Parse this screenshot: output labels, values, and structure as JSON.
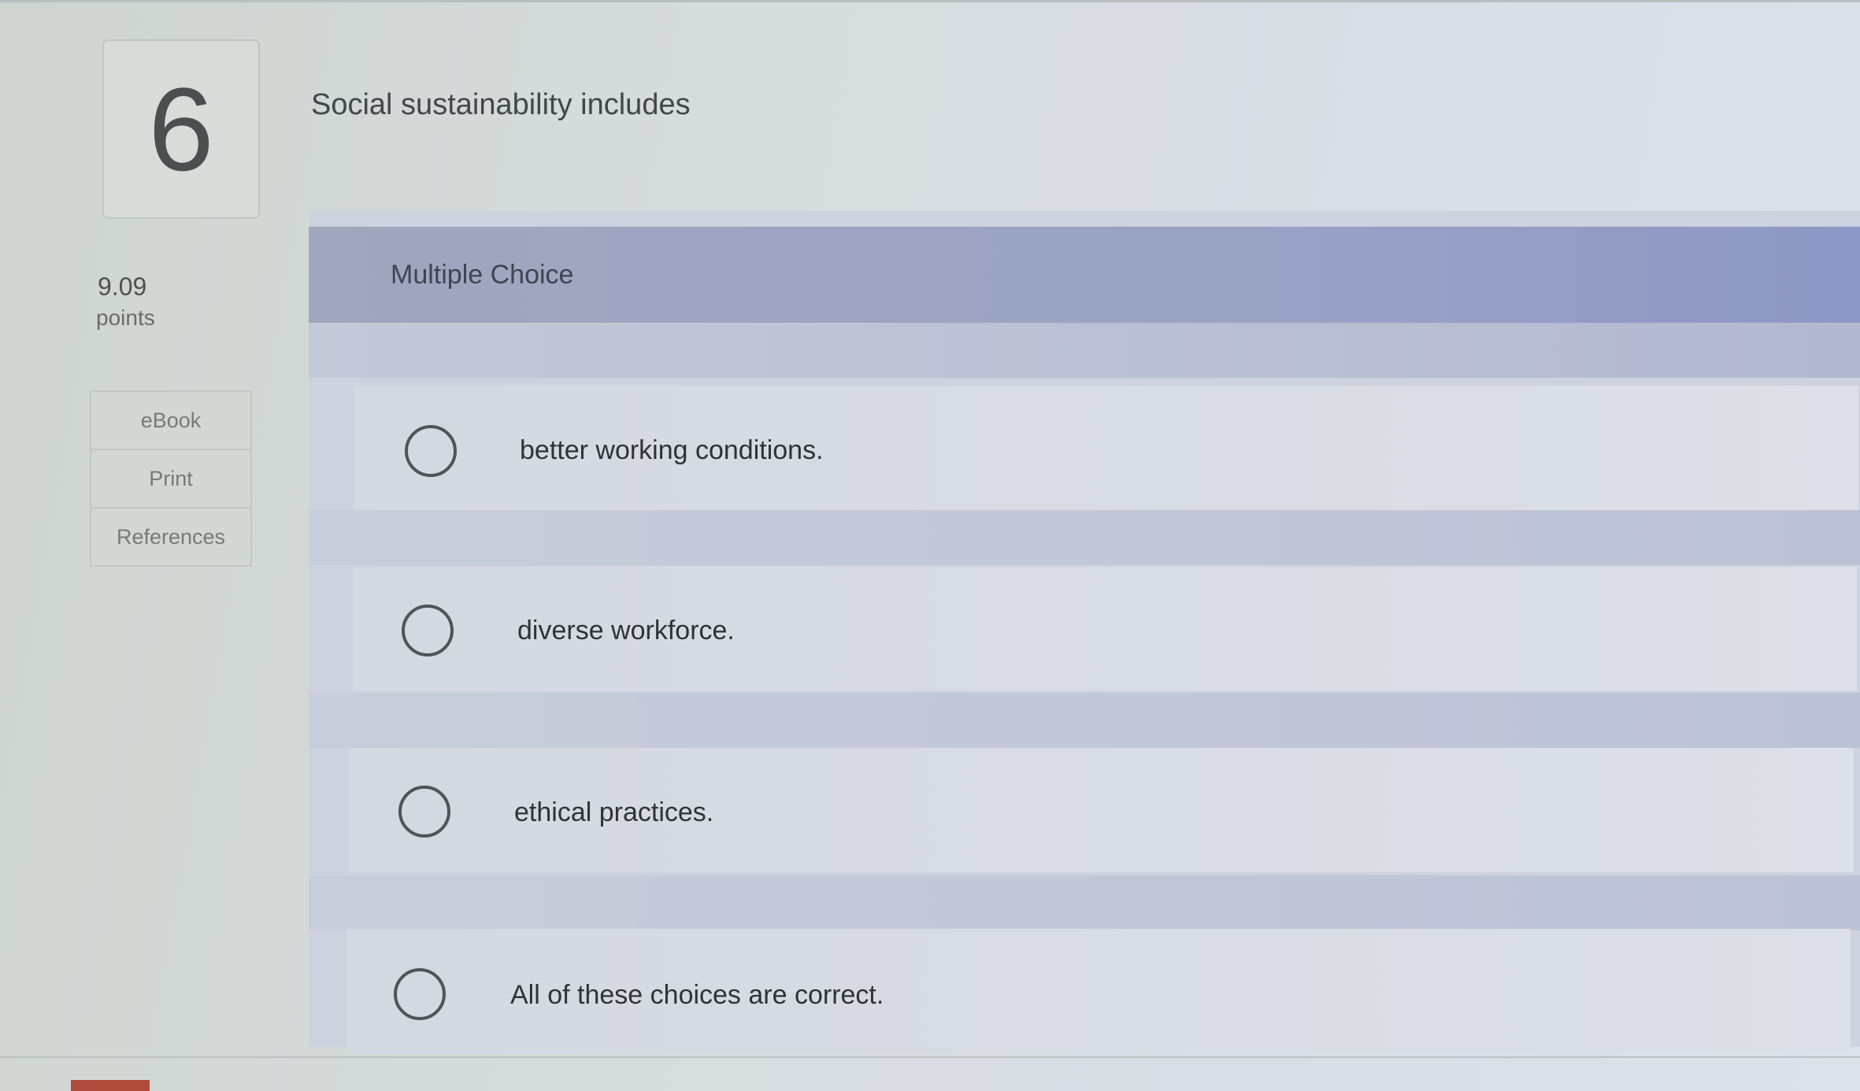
{
  "question": {
    "number": "6",
    "text": "Social sustainability includes",
    "points_value": "9.09",
    "points_label": "points",
    "type_label": "Multiple Choice"
  },
  "side_tools": [
    {
      "label": "eBook"
    },
    {
      "label": "Print"
    },
    {
      "label": "References"
    }
  ],
  "choices": [
    {
      "label": "better working conditions."
    },
    {
      "label": "diverse workforce."
    },
    {
      "label": "ethical practices."
    },
    {
      "label": "All of these choices are correct."
    }
  ],
  "colors": {
    "header": "#9aa2c4",
    "bottom_tab": "#b04a3a"
  }
}
